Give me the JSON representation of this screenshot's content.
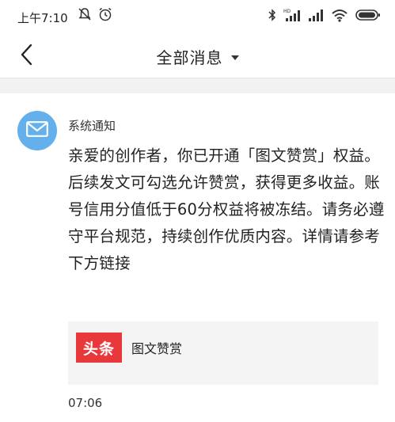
{
  "status_bar": {
    "time": "上午7:10",
    "icons": [
      "alarm-off-icon",
      "clock-icon",
      "bluetooth-icon",
      "hd-signal-icon",
      "signal-icon",
      "wifi-icon",
      "battery-icon"
    ]
  },
  "header": {
    "title": "全部消息",
    "back_icon": "chevron-left-icon",
    "dropdown_icon": "caret-down-icon"
  },
  "message": {
    "sender": "系统通知",
    "avatar_icon": "envelope-icon",
    "avatar_color": "#63b0ec",
    "body": "亲爱的创作者，你已开通「图文赞赏」权益。后续发文可勾选允许赞赏，获得更多收益。账号信用分值低于60分权益将被冻结。请务必遵守平台规范，持续创作优质内容。详情请参考下方链接",
    "link": {
      "logo_text": "头条",
      "logo_color": "#e8383c",
      "title": "图文赞赏"
    },
    "time": "07:06"
  }
}
